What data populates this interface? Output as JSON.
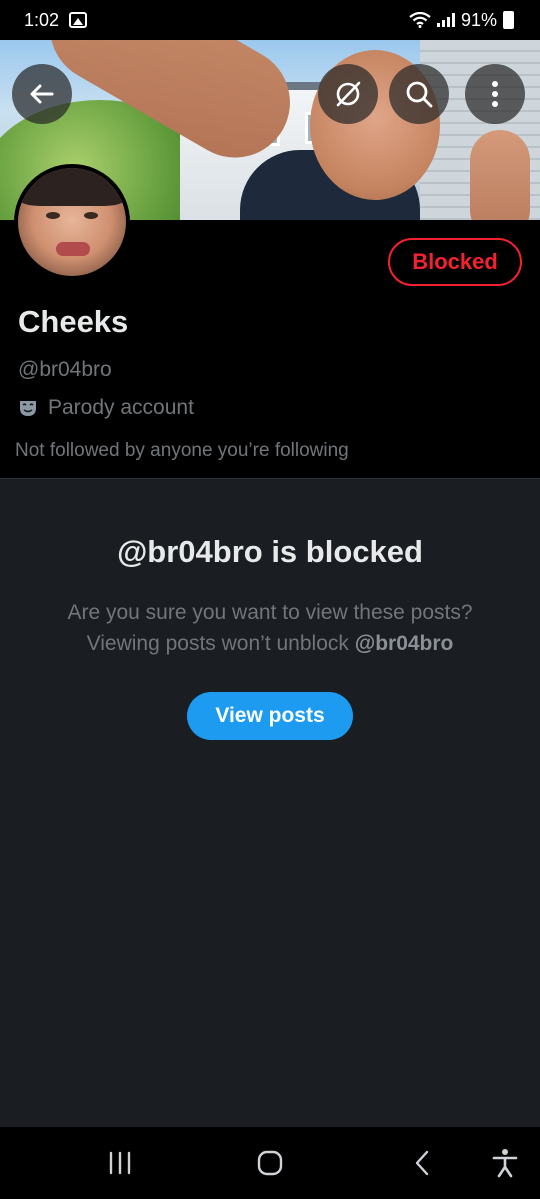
{
  "status_bar": {
    "time": "1:02",
    "battery": "91%"
  },
  "profile": {
    "display_name": "Cheeks",
    "handle": "@br04bro",
    "parody_label": "Parody account",
    "followers_note": "Not followed by anyone you’re following",
    "blocked_button_label": "Blocked"
  },
  "blocked_panel": {
    "title": "@br04bro is blocked",
    "line1": "Are you sure you want to view these posts?",
    "line2_prefix": "Viewing posts won’t unblock ",
    "line2_handle": "@br04bro",
    "view_posts_label": "View posts"
  },
  "colors": {
    "accent": "#1d9bf0",
    "blocked_red": "#f4212e",
    "muted_text": "#71767b",
    "primary_text": "#e7e9ea",
    "panel_bg": "#1a1d21"
  },
  "icons": {
    "back": "arrow-left-icon",
    "grok": "grok-icon",
    "search": "search-icon",
    "more": "more-vertical-icon",
    "parody": "theater-mask-icon",
    "nav_recents": "recents-icon",
    "nav_home": "home-icon",
    "nav_back": "nav-back-icon",
    "nav_accessibility": "accessibility-icon"
  }
}
